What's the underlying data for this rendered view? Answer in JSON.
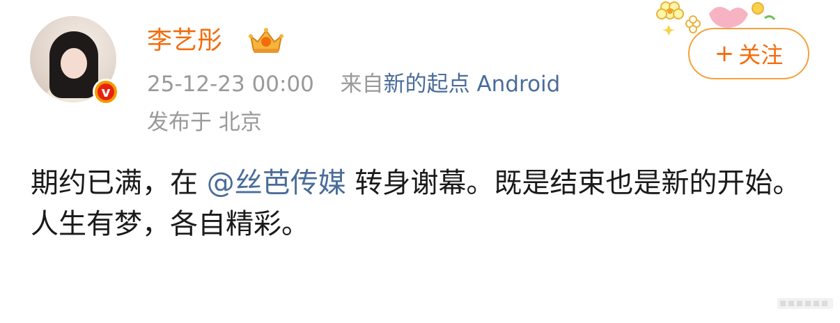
{
  "post": {
    "author": {
      "name": "李艺彤",
      "verified_badge": "v",
      "crown_icon": "crown-member-icon"
    },
    "timestamp": "25-12-23 00:00",
    "source_prefix": "来自",
    "source_app": "新的起点 Android",
    "location": "发布于 北京",
    "follow_button": {
      "icon": "+",
      "label": "关注"
    },
    "content": {
      "line1_before": "期约已满，在 ",
      "mention": "@丝芭传媒",
      "line1_after": " 转身谢幕。既是结束也是新的开始。",
      "line2": "人生有梦，各自精彩。"
    }
  },
  "colors": {
    "name": "#f36c0c",
    "meta": "#999999",
    "link": "#4a6c9a",
    "follow_border": "#f6a03a",
    "badge": "#f29a00"
  }
}
